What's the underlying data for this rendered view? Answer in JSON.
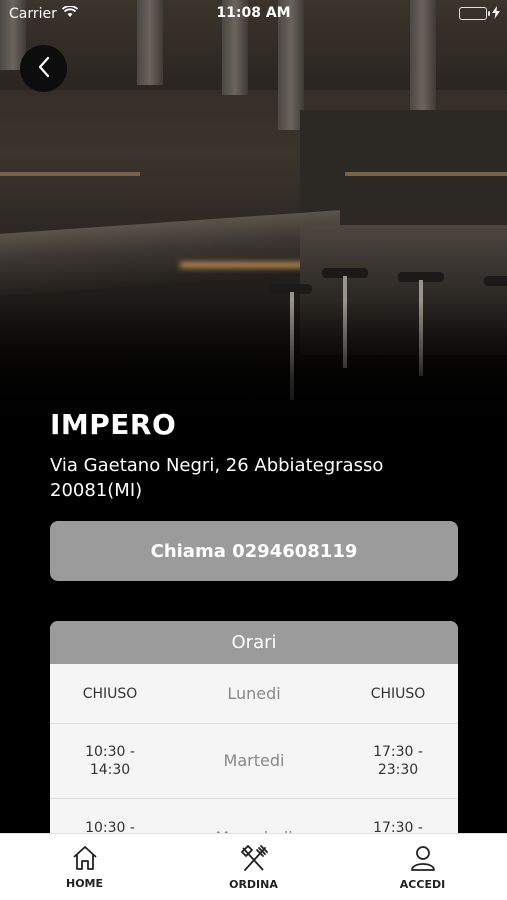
{
  "status_bar": {
    "carrier": "Carrier",
    "time": "11:08 AM"
  },
  "restaurant": {
    "name": "IMPERO",
    "address": "Via Gaetano Negri, 26 Abbiategrasso 20081(MI)"
  },
  "call_button": {
    "label": "Chiama 0294608119"
  },
  "hours": {
    "title": "Orari",
    "rows": [
      {
        "morning": "CHIUSO",
        "day": "Lunedi",
        "evening": "CHIUSO"
      },
      {
        "morning": "10:30 - 14:30",
        "day": "Martedi",
        "evening": "17:30 - 23:30"
      },
      {
        "morning": "10:30 -",
        "day": "Mercoledi",
        "evening": "17:30 -"
      }
    ]
  },
  "tabbar": {
    "home": "HOME",
    "ordina": "ORDINA",
    "accedi": "ACCEDI"
  },
  "colors": {
    "button_gray": "#9b9b9b",
    "battery_green": "#4cd964",
    "background": "#000000"
  },
  "icons": [
    "back-icon",
    "wifi-icon",
    "battery-icon",
    "home-icon",
    "cutlery-icon",
    "user-icon"
  ]
}
